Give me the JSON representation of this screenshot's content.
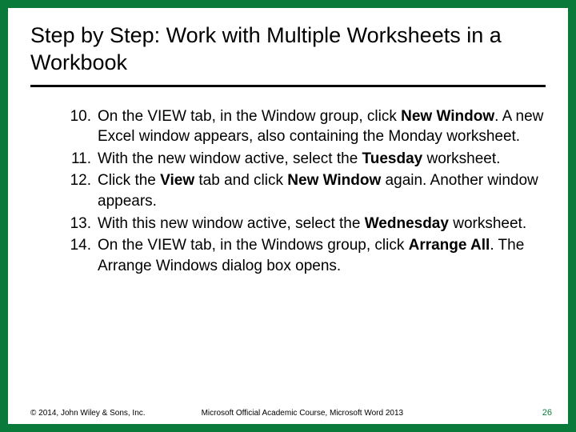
{
  "title": "Step by Step: Work with Multiple Worksheets in a Workbook",
  "steps": [
    {
      "num": "10.",
      "segs": [
        "On the VIEW tab, in the Window group, click ",
        {
          "b": "New Window"
        },
        ". A new Excel window appears, also containing the Monday worksheet."
      ]
    },
    {
      "num": "11.",
      "segs": [
        "With the new window active, select the ",
        {
          "b": "Tuesday"
        },
        " worksheet."
      ]
    },
    {
      "num": "12.",
      "segs": [
        "Click the ",
        {
          "b": "View"
        },
        " tab and click ",
        {
          "b": "New Window"
        },
        " again. Another window appears."
      ]
    },
    {
      "num": "13.",
      "segs": [
        "With this new window active, select the ",
        {
          "b": "Wednesday"
        },
        " worksheet."
      ]
    },
    {
      "num": "14.",
      "segs": [
        "On the VIEW tab, in the Windows group, click ",
        {
          "b": "Arrange All"
        },
        ". The Arrange Windows dialog box opens."
      ]
    }
  ],
  "footer": {
    "copyright": "© 2014, John Wiley & Sons, Inc.",
    "course": "Microsoft Official Academic Course, Microsoft Word 2013",
    "page": "26"
  }
}
